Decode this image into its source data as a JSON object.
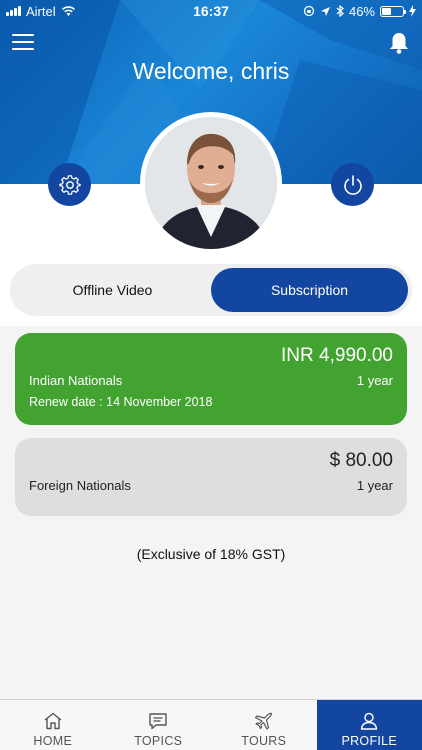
{
  "status_bar": {
    "carrier": "Airtel",
    "time": "16:37",
    "battery": "46%"
  },
  "header": {
    "welcome": "Welcome, chris"
  },
  "segments": [
    {
      "label": "Offline Video",
      "active": false
    },
    {
      "label": "Subscription",
      "active": true
    }
  ],
  "plans": [
    {
      "price": "INR 4,990.00",
      "name": "Indian Nationals",
      "duration": "1 year",
      "renew": "Renew date : 14 November 2018"
    },
    {
      "price": "$ 80.00",
      "name": "Foreign Nationals",
      "duration": "1 year"
    }
  ],
  "note": "(Exclusive of 18% GST)",
  "tabs": [
    {
      "label": "HOME",
      "icon": "home-icon"
    },
    {
      "label": "TOPICS",
      "icon": "topics-icon"
    },
    {
      "label": "TOURS",
      "icon": "plane-icon"
    },
    {
      "label": "PROFILE",
      "icon": "profile-icon",
      "active": true
    }
  ],
  "colors": {
    "primary": "#1246a0",
    "header": "#1573c7",
    "green": "#43a330"
  }
}
